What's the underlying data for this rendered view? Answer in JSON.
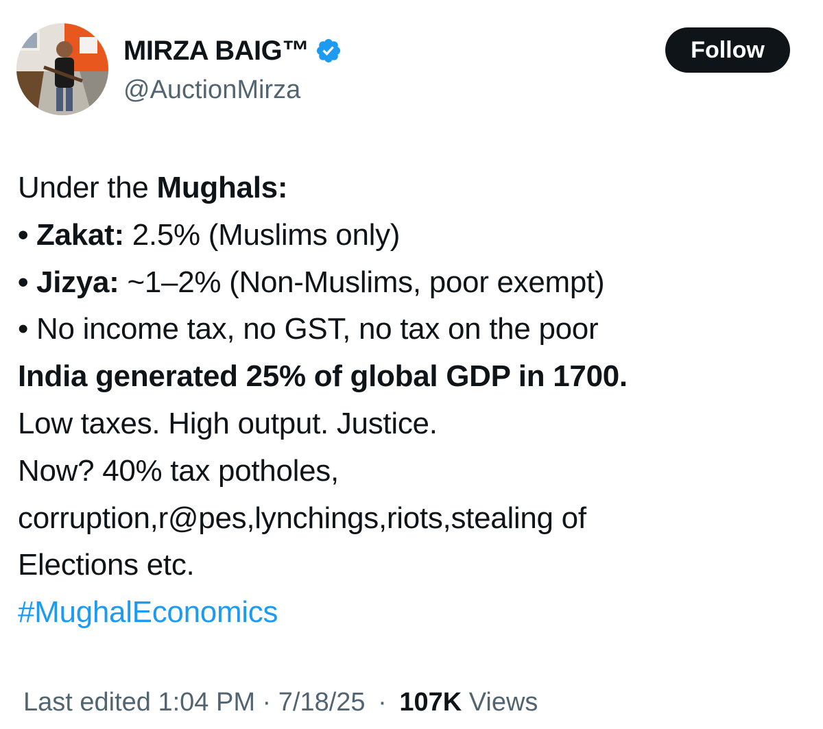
{
  "author": {
    "display_name": "MIRZA BAIG™",
    "handle": "@AuctionMirza",
    "verified": true,
    "verified_color": "#1d9bf0",
    "avatar_icon": "profile-photo"
  },
  "follow_button": {
    "label": "Follow",
    "background": "#0f1419",
    "text_color": "#ffffff"
  },
  "tweet": {
    "intro_plain": "Under the ",
    "intro_bold": "Mughals:",
    "bullet_zakat_label": "• Zakat:",
    "bullet_zakat_text": " 2.5% (Muslims only)",
    "bullet_jizya_label": "• Jizya:",
    "bullet_jizya_text": " ~1–2% (Non-Muslims, poor exempt)",
    "bullet_no_tax": "• No income tax, no GST, no tax on the poor",
    "gdp_line": "India generated 25% of global GDP in 1700.",
    "line_low_taxes": "Low taxes. High output. Justice.",
    "line_now": "Now? 40% tax potholes,",
    "line_corruption": "corruption,r@pes,lynchings,riots,stealing of",
    "line_elections": "Elections etc.",
    "hashtag": "#MughalEconomics",
    "hashtag_color": "#1d9bf0"
  },
  "meta": {
    "edited_text": "Last edited 1:04 PM · 7/18/25",
    "separator": "·",
    "views_count": "107K",
    "views_label": "Views"
  }
}
